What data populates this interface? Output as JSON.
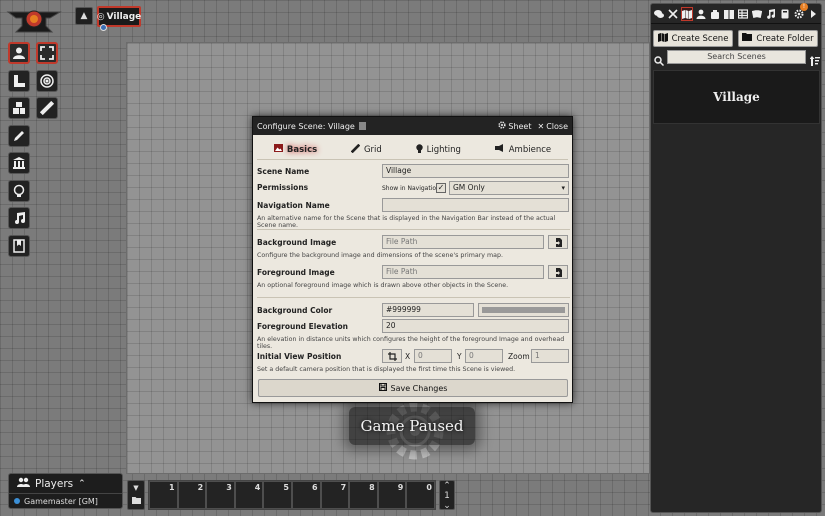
{
  "navigation": {
    "toggle_icon": "chevron-up",
    "current_scene": "Village"
  },
  "dialog": {
    "title": "Configure Scene: Village",
    "sheet_label": "Sheet",
    "close_label": "Close",
    "tabs": [
      {
        "label": "Basics",
        "icon": "image-icon",
        "active": true
      },
      {
        "label": "Grid",
        "icon": "ruler-icon",
        "active": false
      },
      {
        "label": "Lighting",
        "icon": "bulb-icon",
        "active": false
      },
      {
        "label": "Ambience",
        "icon": "music-icon",
        "active": false
      }
    ],
    "scene_name_label": "Scene Name",
    "scene_name_value": "Village",
    "permissions_label": "Permissions",
    "show_in_nav_label": "Show in Navigation",
    "show_in_nav_checked": true,
    "permission_value": "GM Only",
    "nav_name_label": "Navigation Name",
    "nav_name_value": "",
    "nav_name_hint": "An alternative name for the Scene that is displayed in the Navigation Bar instead of the actual Scene name.",
    "bg_image_label": "Background Image",
    "bg_image_placeholder": "File Path",
    "bg_image_hint": "Configure the background image and dimensions of the scene's primary map.",
    "fg_image_label": "Foreground Image",
    "fg_image_placeholder": "File Path",
    "fg_image_hint": "An optional foreground image which is drawn above other objects in the Scene.",
    "bg_color_label": "Background Color",
    "bg_color_value": "#999999",
    "fg_elevation_label": "Foreground Elevation",
    "fg_elevation_value": "20",
    "fg_elevation_hint": "An elevation in distance units which configures the height of the foreground Image and overhead tiles.",
    "initial_view_label": "Initial View Position",
    "x_label": "X",
    "x_placeholder": "0",
    "y_label": "Y",
    "y_placeholder": "0",
    "zoom_label": "Zoom",
    "zoom_placeholder": "1",
    "initial_view_hint": "Set a default camera position that is displayed the first time this Scene is viewed.",
    "save_label": "Save Changes"
  },
  "pause": {
    "label": "Game Paused"
  },
  "players": {
    "title": "Players",
    "users": [
      {
        "name": "Gamemaster [GM]",
        "color": "#3b8fd6"
      }
    ]
  },
  "hotbar": {
    "slots": [
      "1",
      "2",
      "3",
      "4",
      "5",
      "6",
      "7",
      "8",
      "9",
      "0"
    ],
    "page": "1"
  },
  "sidebar": {
    "tabs": [
      "chat-icon",
      "combat-icon",
      "scenes-icon",
      "actors-icon",
      "items-icon",
      "journal-icon",
      "tables-icon",
      "cards-icon",
      "playlists-icon",
      "compendium-icon",
      "settings-icon",
      "collapse-icon"
    ],
    "active_tab": "scenes-icon",
    "create_scene_label": "Create Scene",
    "create_folder_label": "Create Folder",
    "search_placeholder": "Search Scenes",
    "scenes": [
      {
        "name": "Village"
      }
    ]
  },
  "colors": {
    "accent": "#c0392b",
    "dialog_bg": "#ece8df",
    "scene_bg": "#999999"
  }
}
